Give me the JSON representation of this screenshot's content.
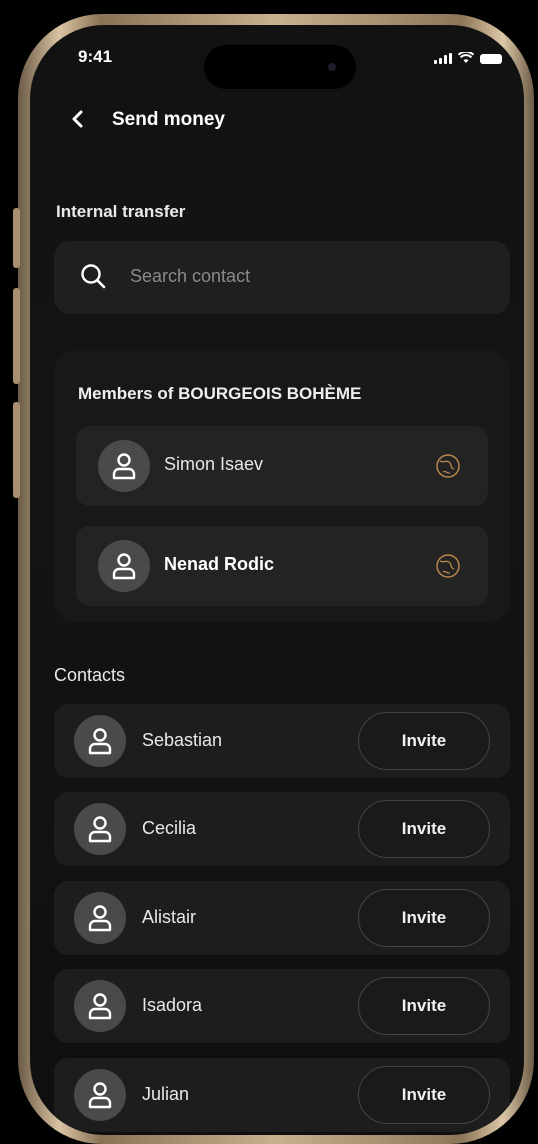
{
  "status_bar": {
    "time": "9:41"
  },
  "header": {
    "back_icon": "chevron-left-icon",
    "title": "Send money"
  },
  "internal_transfer": {
    "title": "Internal transfer",
    "search": {
      "icon": "search-icon",
      "placeholder": "Search contact",
      "value": ""
    }
  },
  "members": {
    "title": "Members of BOURGEOIS BOHÈME",
    "items": [
      {
        "name": "Simon Isaev",
        "icon": "globe-icon"
      },
      {
        "name": "Nenad Rodic",
        "icon": "globe-icon"
      }
    ]
  },
  "contacts": {
    "title": "Contacts",
    "items": [
      {
        "name": "Sebastian",
        "action": "Invite"
      },
      {
        "name": "Cecilia",
        "action": "Invite"
      },
      {
        "name": "Alistair",
        "action": "Invite"
      },
      {
        "name": "Isadora",
        "action": "Invite"
      },
      {
        "name": "Julian",
        "action": "Invite"
      }
    ]
  },
  "colors": {
    "background": "#121212",
    "card": "#1d1d1d",
    "accent_gold": "#b8894a",
    "frame_gold": "#d9c3a3"
  }
}
